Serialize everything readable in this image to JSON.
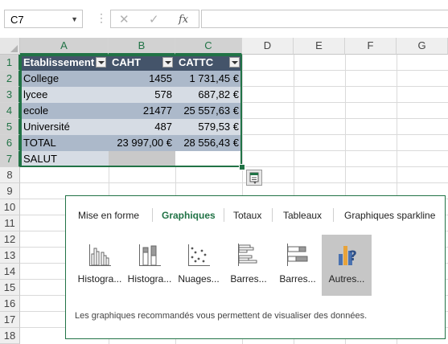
{
  "formula_bar": {
    "name_box": "C7",
    "separator": "⋮",
    "cancel_icon": "✕",
    "enter_icon": "✓",
    "fx_label": "fx",
    "formula": ""
  },
  "columns": [
    "A",
    "B",
    "C",
    "D",
    "E",
    "F",
    "G"
  ],
  "rows": [
    "1",
    "2",
    "3",
    "4",
    "5",
    "6",
    "7",
    "8",
    "9",
    "10",
    "11",
    "12",
    "13",
    "14",
    "15",
    "16",
    "17",
    "18"
  ],
  "table": {
    "headers": [
      "Etablissement",
      "CAHT",
      "CATTC"
    ],
    "data": [
      [
        "College",
        "1455",
        "1 731,45 €"
      ],
      [
        "lycee",
        "578",
        "687,82 €"
      ],
      [
        "ecole",
        "21477",
        "25 557,63 €"
      ],
      [
        "Université",
        "487",
        "579,53 €"
      ],
      [
        "TOTAL",
        "23 997,00 €",
        "28 556,43 €"
      ],
      [
        "SALUT",
        "",
        ""
      ]
    ]
  },
  "quick_analysis": {
    "tabs": [
      "Mise en forme",
      "Graphiques",
      "Totaux",
      "Tableaux",
      "Graphiques sparkline"
    ],
    "active_tab": "Graphiques",
    "items": [
      {
        "label": "Histogra...",
        "icon": "clustered-column-icon"
      },
      {
        "label": "Histogra...",
        "icon": "stacked-column-icon"
      },
      {
        "label": "Nuages...",
        "icon": "scatter-icon"
      },
      {
        "label": "Barres...",
        "icon": "clustered-bar-icon"
      },
      {
        "label": "Barres...",
        "icon": "stacked-bar-icon"
      },
      {
        "label": "Autres...",
        "icon": "more-charts-icon"
      }
    ],
    "description": "Les graphiques recommandés vous permettent de visualiser des données."
  },
  "colors": {
    "accent": "#217346",
    "table_header": "#44546a",
    "band_dark": "#acb9ca",
    "band_light": "#d6dce4"
  }
}
